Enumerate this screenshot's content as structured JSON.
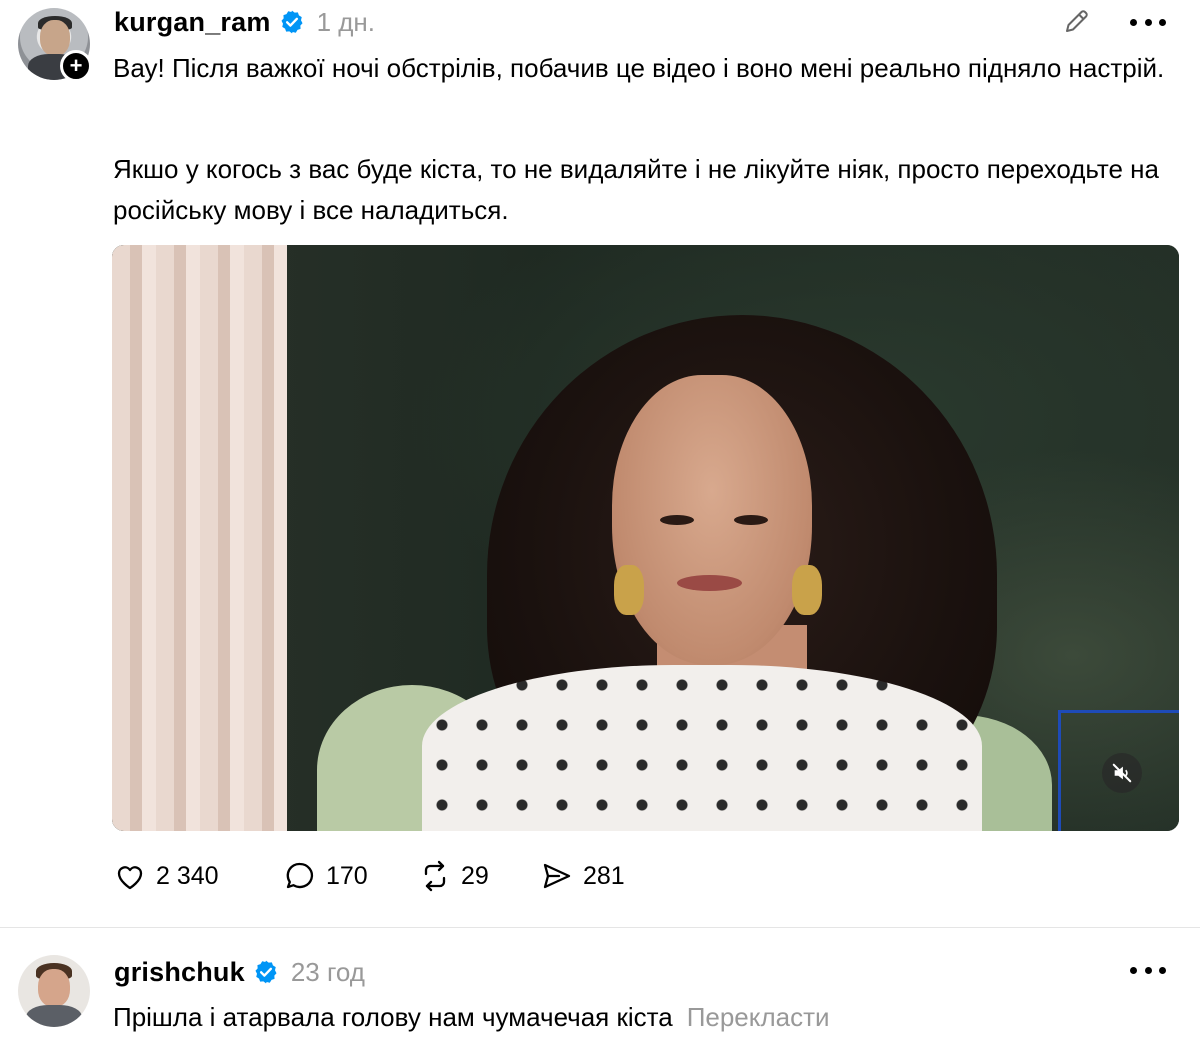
{
  "post": {
    "username": "kurgan_ram",
    "time": "1 дн.",
    "paragraph1": "Вау! Після важкої ночі обстрілів, побачив це відео і воно мені реально підняло настрій.",
    "paragraph2": "Якшо у когось з вас буде кіста, то не видаляйте і не лікуйте ніяк, просто переходьте на російську мову і все наладиться.",
    "follow_badge": "+",
    "icons": {
      "edit": "pencil-icon",
      "more": "more-icon",
      "verified": "verified-badge-icon",
      "mute": "muted-speaker-icon"
    },
    "actions": {
      "likes": "2 340",
      "comments": "170",
      "reposts": "29",
      "shares": "281"
    }
  },
  "reply": {
    "username": "grishchuk",
    "time": "23 год",
    "text": "Прішла і атарвала голову нам чумачечая кіста",
    "translate_label": "Перекласти"
  },
  "colors": {
    "verified_blue": "#0095f6",
    "muted_text": "#999999",
    "divider": "#e5e5e5"
  }
}
